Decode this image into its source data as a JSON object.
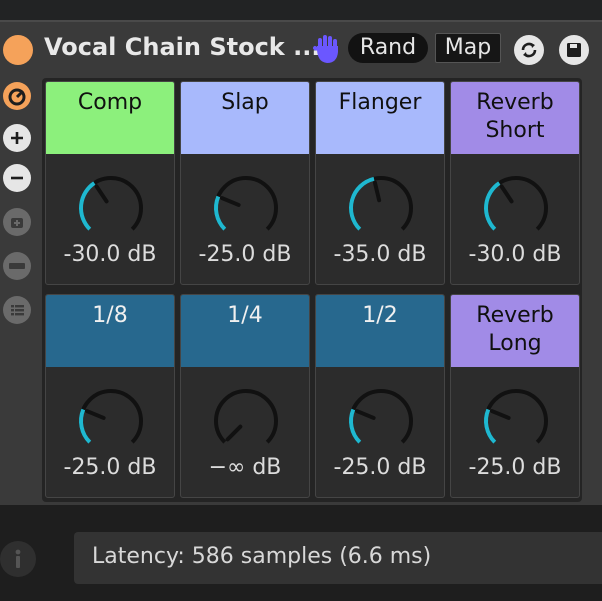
{
  "device": {
    "title": "Vocal Chain Stock ...",
    "rand_label": "Rand",
    "map_label": "Map",
    "icons": [
      "power-icon",
      "hand-icon",
      "hot-swap-icon",
      "save-icon"
    ],
    "power_color": "#f5a25a"
  },
  "sidebar": {
    "icons": [
      "rack-chain-icon",
      "add-macro-icon",
      "remove-macro-icon",
      "snapshot-icon",
      "map-macro-icon",
      "list-icon"
    ]
  },
  "macros": [
    {
      "label": "Comp",
      "value": "-30.0 dB",
      "color": "#8cf07c",
      "level": 0.375
    },
    {
      "label": "Slap",
      "value": "-25.0 dB",
      "color": "#a8b9fc",
      "level": 0.25
    },
    {
      "label": "Flanger",
      "value": "-35.0 dB",
      "color": "#a8b9fc",
      "level": 0.45
    },
    {
      "label": "Reverb\nShort",
      "value": "-30.0 dB",
      "color": "#a18be7",
      "level": 0.375
    },
    {
      "label": "1/8",
      "value": "-25.0 dB",
      "color": "#27688e",
      "level": 0.25
    },
    {
      "label": "1/4",
      "value": "−∞ dB",
      "color": "#27688e",
      "level": 0.0
    },
    {
      "label": "1/2",
      "value": "-25.0 dB",
      "color": "#27688e",
      "level": 0.25
    },
    {
      "label": "Reverb\nLong",
      "value": "-25.0 dB",
      "color": "#a18be7",
      "level": 0.25
    }
  ],
  "footer": {
    "latency": "Latency: 586 samples (6.6 ms)",
    "info_icon": "info-icon"
  },
  "colors": {
    "knob_arc": "#1fb8d0",
    "knob_ring": "#111111",
    "panel": "#3a3a3a"
  }
}
